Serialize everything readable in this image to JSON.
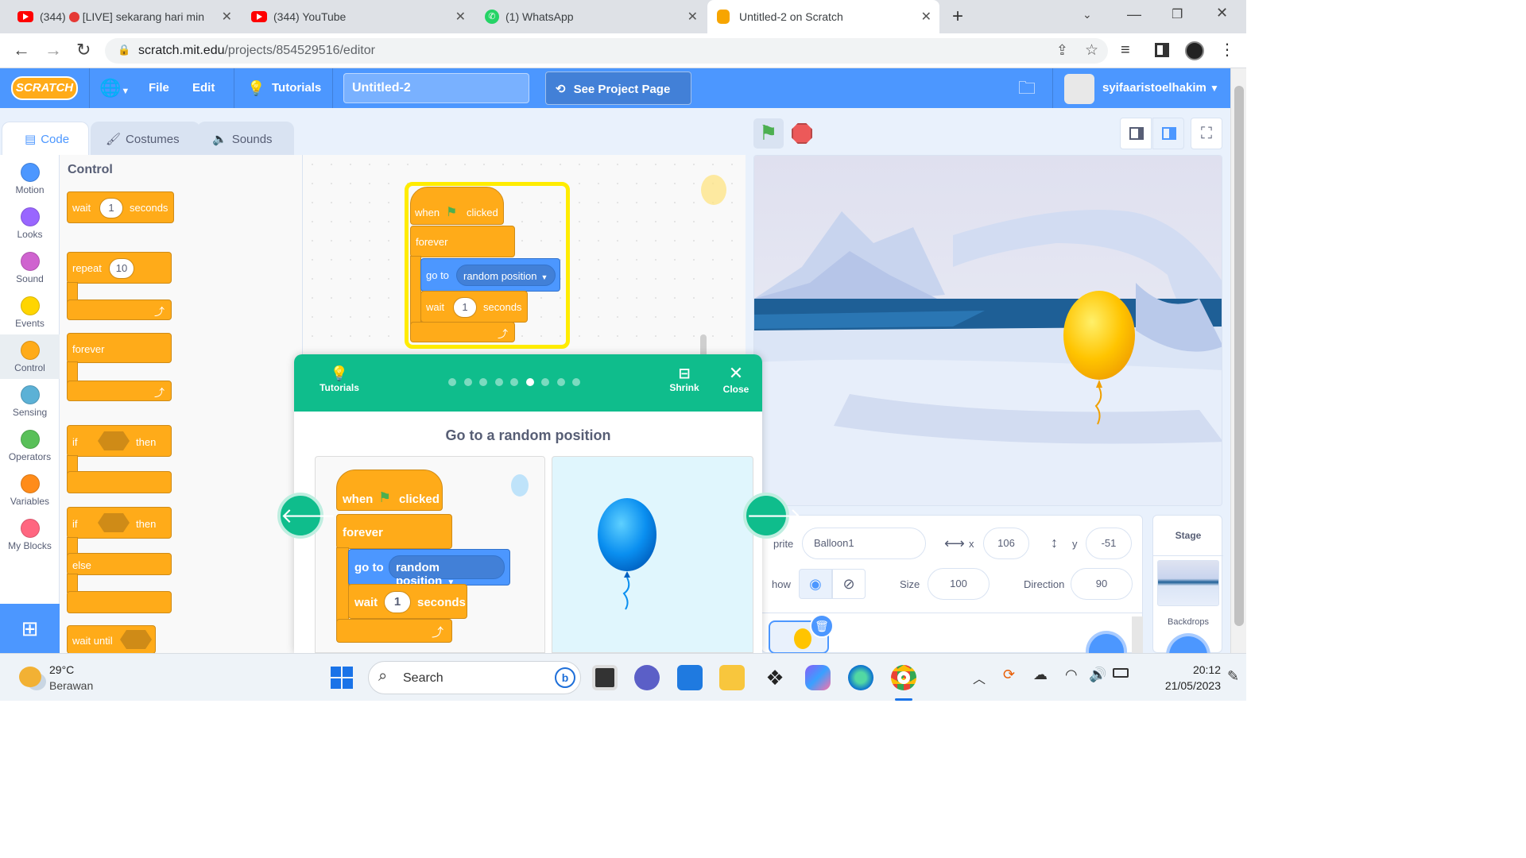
{
  "browser": {
    "tabs": [
      {
        "title": "(344) 🔴[LIVE] sekarang hari min",
        "count": "(344)",
        "label": "[LIVE] sekarang hari min"
      },
      {
        "title": "(344) YouTube"
      },
      {
        "title": "(1) WhatsApp"
      },
      {
        "title": "Untitled-2 on Scratch"
      }
    ],
    "url_domain": "scratch.mit.edu",
    "url_path": "/projects/854529516/editor",
    "new_tab": "+"
  },
  "menu": {
    "logo": "SCRATCH",
    "file": "File",
    "edit": "Edit",
    "tutorials": "Tutorials",
    "project_title": "Untitled-2",
    "see_project": "See Project Page",
    "username": "syifaaristoelhakim"
  },
  "editor_tabs": {
    "code": "Code",
    "costumes": "Costumes",
    "sounds": "Sounds"
  },
  "categories": [
    {
      "label": "Motion",
      "color": "#4c97ff"
    },
    {
      "label": "Looks",
      "color": "#9966ff"
    },
    {
      "label": "Sound",
      "color": "#cf63cf"
    },
    {
      "label": "Events",
      "color": "#ffd500"
    },
    {
      "label": "Control",
      "color": "#ffab19"
    },
    {
      "label": "Sensing",
      "color": "#5cb1d6"
    },
    {
      "label": "Operators",
      "color": "#59c059"
    },
    {
      "label": "Variables",
      "color": "#ff8c1a"
    },
    {
      "label": "My Blocks",
      "color": "#ff6680"
    }
  ],
  "palette": {
    "header": "Control",
    "wait": "wait",
    "wait_val": "1",
    "seconds": "seconds",
    "repeat": "repeat",
    "repeat_val": "10",
    "forever": "forever",
    "if": "if",
    "then": "then",
    "else": "else",
    "wait_until": "wait until"
  },
  "script": {
    "when": "when",
    "clicked": "clicked",
    "forever": "forever",
    "go_to": "go to",
    "random_position": "random position",
    "wait": "wait",
    "wait_val": "1",
    "seconds": "seconds"
  },
  "tutorial": {
    "tutorials": "Tutorials",
    "shrink": "Shrink",
    "close": "Close",
    "title": "Go to a random position",
    "step_count": 9,
    "current_step": 6
  },
  "sprite": {
    "label": "prite",
    "name": "Balloon1",
    "x_label": "x",
    "x": "106",
    "y_label": "y",
    "y": "-51",
    "show_label": "how",
    "size_label": "Size",
    "size": "100",
    "direction_label": "Direction",
    "direction": "90"
  },
  "stage_panel": {
    "title": "Stage",
    "backdrops": "Backdrops"
  },
  "taskbar": {
    "temp": "29°C",
    "weather": "Berawan",
    "search": "Search",
    "time": "20:12",
    "date": "21/05/2023"
  }
}
